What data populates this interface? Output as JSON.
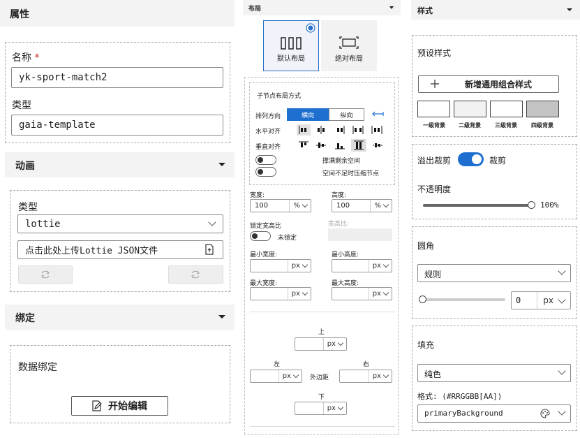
{
  "left": {
    "header": "属性",
    "name_label": "名称",
    "required_mark": "*",
    "name_value": "yk-sport-match2",
    "type_label": "类型",
    "type_value": "gaia-template",
    "animation": {
      "header": "动画",
      "type_label": "类型",
      "type_value": "lottie",
      "upload_label": "点击此处上传Lottie JSON文件"
    },
    "binding": {
      "header": "绑定",
      "data_binding_label": "数据绑定",
      "start_edit_label": "开始编辑"
    }
  },
  "middle": {
    "header": "布局",
    "default_layout": "默认布局",
    "absolute_layout": "绝对布局",
    "child_layout_title": "子节点布局方式",
    "direction_label": "排列方向",
    "horizontal": "横向",
    "vertical": "纵向",
    "h_align_label": "水平对齐",
    "v_align_label": "垂直对齐",
    "fill_space": "撑满剩余空间",
    "shrink": "空间不足时压缩节点",
    "width_label": "宽度:",
    "height_label": "高度:",
    "width_value": "100",
    "height_value": "100",
    "unit_percent": "%",
    "unit_px": "px",
    "lock_ratio_label": "锁定宽高比",
    "ratio_label": "宽高比:",
    "unlocked": "未锁定",
    "min_width": "最小宽度:",
    "min_height": "最小高度:",
    "max_width": "最大宽度:",
    "max_height": "最大高度:",
    "top": "上",
    "left": "左",
    "right": "右",
    "bottom": "下",
    "margin": "外边距"
  },
  "right": {
    "header": "样式",
    "preset_label": "预设样式",
    "add_style": "新增通用组合样式",
    "swatches": [
      {
        "label": "一级背景",
        "color": "#ffffff"
      },
      {
        "label": "二级背景",
        "color": "#f2f2f2"
      },
      {
        "label": "三级背景",
        "color": "#ffffff"
      },
      {
        "label": "四级背景",
        "color": "#c4c4c4"
      }
    ],
    "overflow_label": "溢出裁剪",
    "clip_label": "裁剪",
    "opacity_label": "不透明度",
    "opacity_value": "100%",
    "opacity_fraction": 1.0,
    "radius_label": "圆角",
    "radius_select": "规则",
    "radius_value": "0",
    "radius_unit": "px",
    "fill_label": "填充",
    "fill_select": "纯色",
    "format_label": "格式: (#RRGGBB[AA])",
    "fill_value": "primaryBackground",
    "accent": "#1f6fd1"
  }
}
